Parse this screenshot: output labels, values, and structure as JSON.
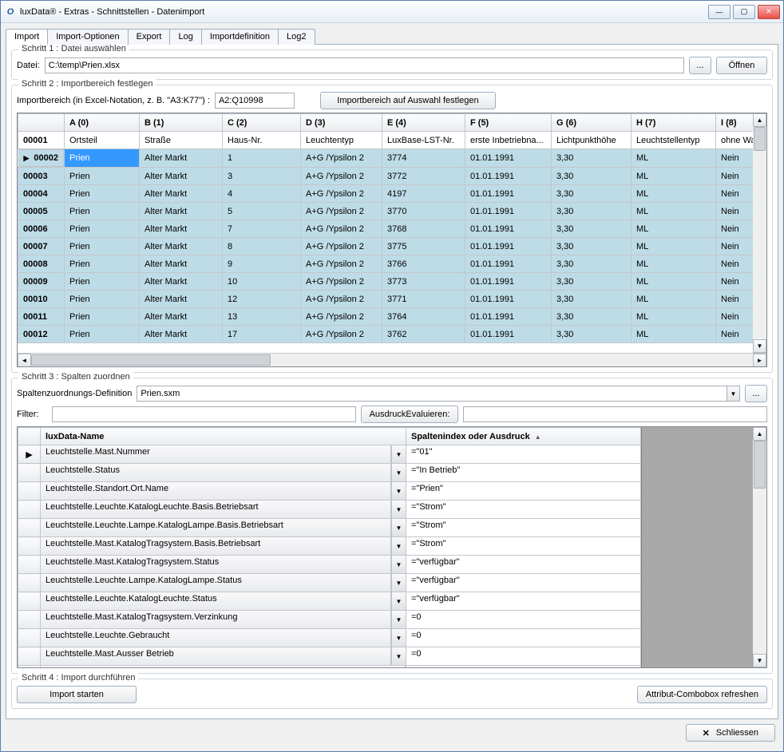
{
  "window": {
    "title": "luxData® - Extras - Schnittstellen - Datenimport"
  },
  "tabs": [
    {
      "label": "Import",
      "active": true
    },
    {
      "label": "Import-Optionen"
    },
    {
      "label": "Export"
    },
    {
      "label": "Log"
    },
    {
      "label": "Importdefinition"
    },
    {
      "label": "Log2"
    }
  ],
  "step1": {
    "legend": "Schritt 1 : Datei auswählen",
    "file_label": "Datei:",
    "file_value": "C:\\temp\\Prien.xlsx",
    "browse": "...",
    "open": "Öffnen"
  },
  "step2": {
    "legend": "Schritt 2 : Importbereich festlegen",
    "range_label": "Importbereich (in Excel-Notation, z. B. \"A3:K77\") :",
    "range_value": "A2:Q10998",
    "apply_range": "Importbereich auf Auswahl festlegen",
    "columns": [
      "",
      "A (0)",
      "B (1)",
      "C (2)",
      "D (3)",
      "E (4)",
      "F (5)",
      "G (6)",
      "H (7)",
      "I (8)"
    ],
    "header_row": [
      "00001",
      "Ortsteil",
      "Straße",
      "Haus-Nr.",
      "Leuchtentyp",
      "LuxBase-LST-Nr.",
      "erste Inbetriebna...",
      "Lichtpunkthöhe",
      "Leuchtstellentyp",
      "ohne Wa"
    ],
    "rows": [
      {
        "num": "00002",
        "sel": true,
        "c": [
          "Prien",
          "Alter Markt",
          "1",
          "A+G  /Ypsilon 2",
          "3774",
          "01.01.1991",
          "3,30",
          "ML",
          "Nein"
        ]
      },
      {
        "num": "00003",
        "c": [
          "Prien",
          "Alter Markt",
          "3",
          "A+G  /Ypsilon 2",
          "3772",
          "01.01.1991",
          "3,30",
          "ML",
          "Nein"
        ]
      },
      {
        "num": "00004",
        "c": [
          "Prien",
          "Alter Markt",
          "4",
          "A+G  /Ypsilon 2",
          "4197",
          "01.01.1991",
          "3,30",
          "ML",
          "Nein"
        ]
      },
      {
        "num": "00005",
        "c": [
          "Prien",
          "Alter Markt",
          "5",
          "A+G  /Ypsilon 2",
          "3770",
          "01.01.1991",
          "3,30",
          "ML",
          "Nein"
        ]
      },
      {
        "num": "00006",
        "c": [
          "Prien",
          "Alter Markt",
          "7",
          "A+G  /Ypsilon 2",
          "3768",
          "01.01.1991",
          "3,30",
          "ML",
          "Nein"
        ]
      },
      {
        "num": "00007",
        "c": [
          "Prien",
          "Alter Markt",
          "8",
          "A+G  /Ypsilon 2",
          "3775",
          "01.01.1991",
          "3,30",
          "ML",
          "Nein"
        ]
      },
      {
        "num": "00008",
        "c": [
          "Prien",
          "Alter Markt",
          "9",
          "A+G  /Ypsilon 2",
          "3766",
          "01.01.1991",
          "3,30",
          "ML",
          "Nein"
        ]
      },
      {
        "num": "00009",
        "c": [
          "Prien",
          "Alter Markt",
          "10",
          "A+G  /Ypsilon 2",
          "3773",
          "01.01.1991",
          "3,30",
          "ML",
          "Nein"
        ]
      },
      {
        "num": "00010",
        "c": [
          "Prien",
          "Alter Markt",
          "12",
          "A+G  /Ypsilon 2",
          "3771",
          "01.01.1991",
          "3,30",
          "ML",
          "Nein"
        ]
      },
      {
        "num": "00011",
        "c": [
          "Prien",
          "Alter Markt",
          "13",
          "A+G  /Ypsilon 2",
          "3764",
          "01.01.1991",
          "3,30",
          "ML",
          "Nein"
        ]
      },
      {
        "num": "00012",
        "c": [
          "Prien",
          "Alter Markt",
          "17",
          "A+G  /Ypsilon 2",
          "3762",
          "01.01.1991",
          "3,30",
          "ML",
          "Nein"
        ]
      }
    ]
  },
  "step3": {
    "legend": "Schritt 3 : Spalten zuordnen",
    "def_label": "Spaltenzuordnungs-Definition",
    "def_value": "Prien.sxm",
    "browse": "...",
    "filter_label": "Filter:",
    "eval_label": "AusdruckEvaluieren:",
    "col_lux": "luxData-Name",
    "col_expr": "Spaltenindex oder Ausdruck",
    "rows": [
      {
        "lux": "Leuchtstelle.Mast.Nummer",
        "expr": "=\"01\"",
        "sel": true
      },
      {
        "lux": "Leuchtstelle.Status",
        "expr": "=\"In Betrieb\""
      },
      {
        "lux": "Leuchtstelle.Standort.Ort.Name",
        "expr": "=\"Prien\""
      },
      {
        "lux": "Leuchtstelle.Leuchte.KatalogLeuchte.Basis.Betriebsart",
        "expr": "=\"Strom\""
      },
      {
        "lux": "Leuchtstelle.Leuchte.Lampe.KatalogLampe.Basis.Betriebsart",
        "expr": "=\"Strom\""
      },
      {
        "lux": "Leuchtstelle.Mast.KatalogTragsystem.Basis.Betriebsart",
        "expr": "=\"Strom\""
      },
      {
        "lux": "Leuchtstelle.Mast.KatalogTragsystem.Status",
        "expr": "=\"verfügbar\""
      },
      {
        "lux": "Leuchtstelle.Leuchte.Lampe.KatalogLampe.Status",
        "expr": "=\"verfügbar\""
      },
      {
        "lux": "Leuchtstelle.Leuchte.KatalogLeuchte.Status",
        "expr": "=\"verfügbar\""
      },
      {
        "lux": "Leuchtstelle.Mast.KatalogTragsystem.Verzinkung",
        "expr": "=0"
      },
      {
        "lux": "Leuchtstelle.Leuchte.Gebraucht",
        "expr": "=0"
      },
      {
        "lux": "Leuchtstelle.Mast.Ausser Betrieb",
        "expr": "=0"
      }
    ]
  },
  "step4": {
    "legend": "Schritt 4 : Import durchführen",
    "start": "Import starten",
    "refresh": "Attribut-Combobox refreshen"
  },
  "closeBtn": "Schliessen"
}
